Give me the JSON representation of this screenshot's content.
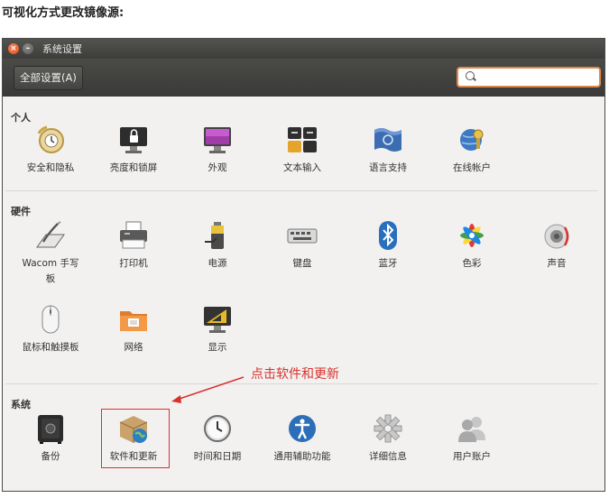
{
  "intro_text": "可视化方式更改镜像源:",
  "window": {
    "title": "系统设置",
    "all_settings_label": "全部设置(A)",
    "search_value": ""
  },
  "sections": {
    "personal": {
      "title": "个人",
      "items": [
        "安全和隐私",
        "亮度和锁屏",
        "外观",
        "文本输入",
        "语言支持",
        "在线帐户"
      ]
    },
    "hardware": {
      "title": "硬件",
      "items": [
        "Wacom 手写\n板",
        "打印机",
        "电源",
        "键盘",
        "蓝牙",
        "色彩",
        "声音",
        "鼠标和触摸板",
        "网络",
        "显示"
      ]
    },
    "system": {
      "title": "系统",
      "items": [
        "备份",
        "软件和更新",
        "时间和日期",
        "通用辅助功能",
        "详细信息",
        "用户账户"
      ]
    }
  },
  "annotation": "点击软件和更新",
  "colors": {
    "accent": "#e0884b",
    "annotation": "#d8322c"
  }
}
